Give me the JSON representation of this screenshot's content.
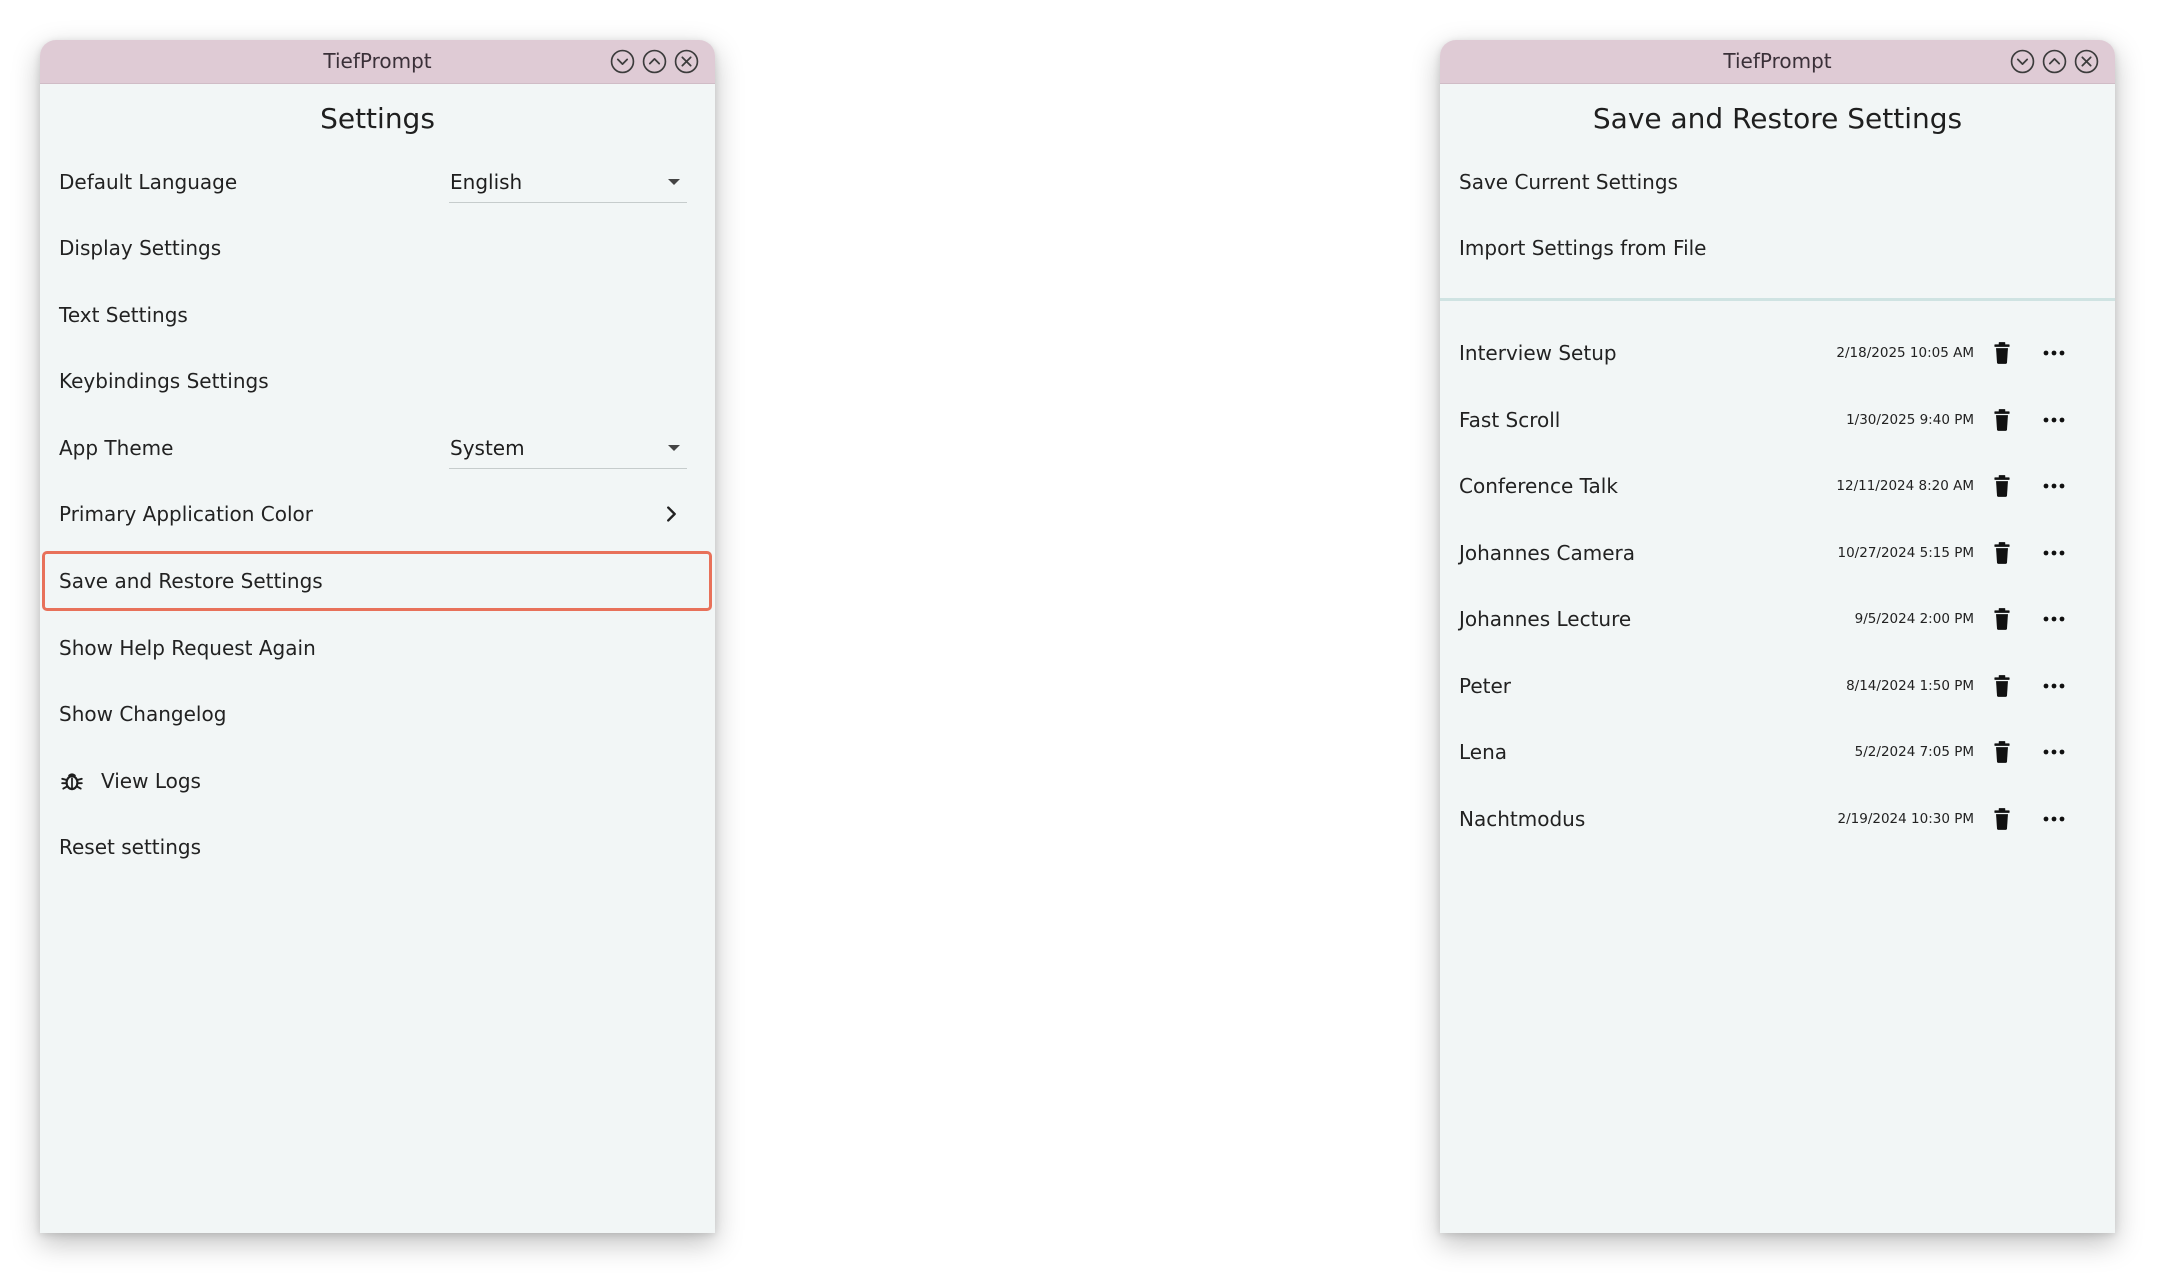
{
  "left_window": {
    "app_title": "TiefPrompt",
    "page_title": "Settings",
    "items": [
      {
        "label": "Default Language",
        "value": "English"
      },
      {
        "label": "Display Settings"
      },
      {
        "label": "Text Settings"
      },
      {
        "label": "Keybindings Settings"
      },
      {
        "label": "App Theme",
        "value": "System"
      },
      {
        "label": "Primary Application Color"
      },
      {
        "label": "Save and Restore Settings",
        "highlighted": true
      },
      {
        "label": "Show Help Request Again"
      },
      {
        "label": "Show Changelog"
      },
      {
        "label": "View Logs",
        "icon": "bug-icon"
      },
      {
        "label": "Reset settings"
      }
    ]
  },
  "right_window": {
    "app_title": "TiefPrompt",
    "page_title": "Save and Restore Settings",
    "actions": [
      {
        "label": "Save Current Settings"
      },
      {
        "label": "Import Settings from File"
      }
    ],
    "saved_settings": [
      {
        "name": "Interview Setup",
        "date": "2/18/2025 10:05 AM"
      },
      {
        "name": "Fast Scroll",
        "date": "1/30/2025 9:40 PM"
      },
      {
        "name": "Conference Talk",
        "date": "12/11/2024 8:20 AM"
      },
      {
        "name": "Johannes Camera",
        "date": "10/27/2024 5:15 PM"
      },
      {
        "name": "Johannes Lecture",
        "date": "9/5/2024 2:00 PM"
      },
      {
        "name": "Peter",
        "date": "8/14/2024 1:50 PM"
      },
      {
        "name": "Lena",
        "date": "5/2/2024 7:05 PM"
      },
      {
        "name": "Nachtmodus",
        "date": "2/19/2024 10:30 PM"
      }
    ]
  },
  "icons": {
    "window_controls": [
      "minimize-icon",
      "maximize-icon",
      "close-icon"
    ],
    "row_actions": [
      "trash-icon",
      "more-horizontal-icon"
    ],
    "color_row": "chevron-right-icon"
  },
  "colors": {
    "titlebar": "#dfcbd5",
    "background": "#f2f6f6",
    "highlight_border": "#e8715a",
    "divider": "#cfe3e2"
  }
}
